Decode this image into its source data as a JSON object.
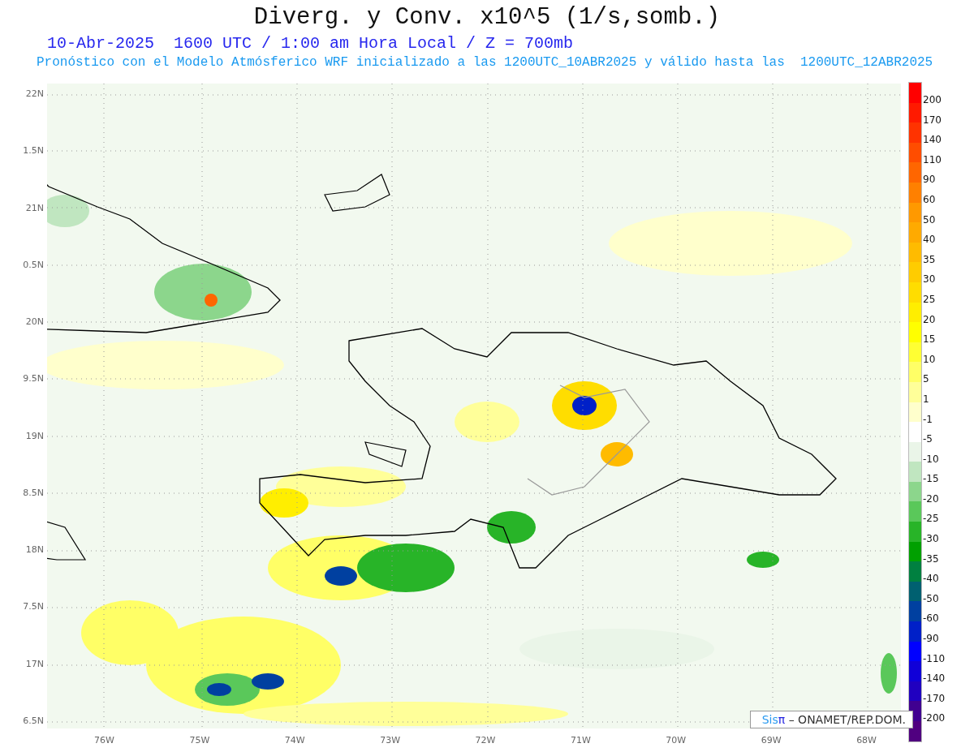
{
  "title": "Diverg. y Conv. x10^5 (1/s,somb.)",
  "subtitle_date": "10-Abr-2025  1600 UTC / 1:00 am Hora Local / Z = 700mb",
  "subtitle_model": "Pronóstico con el Modelo Atmósferico WRF inicializado a las 1200UTC_10ABR2025 y válido hasta las  1200UTC_12ABR2025",
  "map": {
    "lat_labels": [
      "22N",
      "1.5N",
      "21N",
      "0.5N",
      "20N",
      "9.5N",
      "19N",
      "8.5N",
      "18N",
      "7.5N",
      "17N",
      "6.5N"
    ],
    "lon_labels": [
      "76W",
      "75W",
      "74W",
      "73W",
      "72W",
      "71W",
      "70W",
      "69W",
      "68W"
    ]
  },
  "colorbar": {
    "bins": [
      {
        "color": "#ff0000"
      },
      {
        "color": "#ff1a00"
      },
      {
        "color": "#ff3300"
      },
      {
        "color": "#ff4d00"
      },
      {
        "color": "#ff6600"
      },
      {
        "color": "#ff8000"
      },
      {
        "color": "#ff9900"
      },
      {
        "color": "#ffaa00"
      },
      {
        "color": "#ffbb00"
      },
      {
        "color": "#ffcc00"
      },
      {
        "color": "#ffdd00"
      },
      {
        "color": "#ffee00"
      },
      {
        "color": "#ffff00"
      },
      {
        "color": "#ffff33"
      },
      {
        "color": "#ffff66"
      },
      {
        "color": "#ffff99"
      },
      {
        "color": "#ffffcc"
      },
      {
        "color": "#ffffff"
      },
      {
        "color": "#eaf5e8"
      },
      {
        "color": "#c0e6c0"
      },
      {
        "color": "#8cd68c"
      },
      {
        "color": "#5ac85a"
      },
      {
        "color": "#28b428"
      },
      {
        "color": "#00a000"
      },
      {
        "color": "#008040"
      },
      {
        "color": "#006070"
      },
      {
        "color": "#0040a0"
      },
      {
        "color": "#0020c8"
      },
      {
        "color": "#0000ff"
      },
      {
        "color": "#1000d8"
      },
      {
        "color": "#2000c0"
      },
      {
        "color": "#400090"
      },
      {
        "color": "#500080"
      }
    ],
    "labels": [
      "200",
      "170",
      "140",
      "110",
      "90",
      "60",
      "50",
      "40",
      "35",
      "30",
      "25",
      "20",
      "15",
      "10",
      "5",
      "1",
      "-1",
      "-5",
      "-10",
      "-15",
      "-20",
      "-25",
      "-30",
      "-35",
      "-40",
      "-50",
      "-60",
      "-90",
      "-110",
      "-140",
      "-170",
      "-200"
    ]
  },
  "credit": {
    "brand_prefix": "Sis",
    "brand_symbol": "π",
    "text": "– ONAMET/REP.DOM."
  }
}
